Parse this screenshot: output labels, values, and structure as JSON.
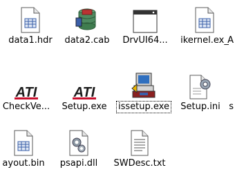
{
  "items": [
    {
      "label": "data1.hdr",
      "icon": "generic-document-icon"
    },
    {
      "label": "data2.cab",
      "icon": "cabinet-archive-icon"
    },
    {
      "label": "DrvUI64...",
      "icon": "application-window-icon"
    },
    {
      "label": "ikernel.ex_",
      "icon": "generic-document-icon"
    },
    {
      "label": "A",
      "icon": "truncated-item-icon"
    },
    {
      "label": "CheckVe...",
      "icon": "ati-logo-icon"
    },
    {
      "label": "Setup.exe",
      "icon": "ati-logo-icon"
    },
    {
      "label": "issetup.exe",
      "icon": "installer-computer-icon",
      "selected": true
    },
    {
      "label": "Setup.ini",
      "icon": "settings-file-icon"
    },
    {
      "label": "s",
      "icon": "truncated-item-icon"
    },
    {
      "label": "ayout.bin",
      "icon": "generic-document-icon"
    },
    {
      "label": "psapi.dll",
      "icon": "dll-gear-icon"
    },
    {
      "label": "SWDesc.txt",
      "icon": "text-file-icon"
    }
  ],
  "colors": {
    "ati_red": "#c8102e",
    "folder_blue": "#3a5fa8",
    "cab_green": "#3f7d4f"
  }
}
